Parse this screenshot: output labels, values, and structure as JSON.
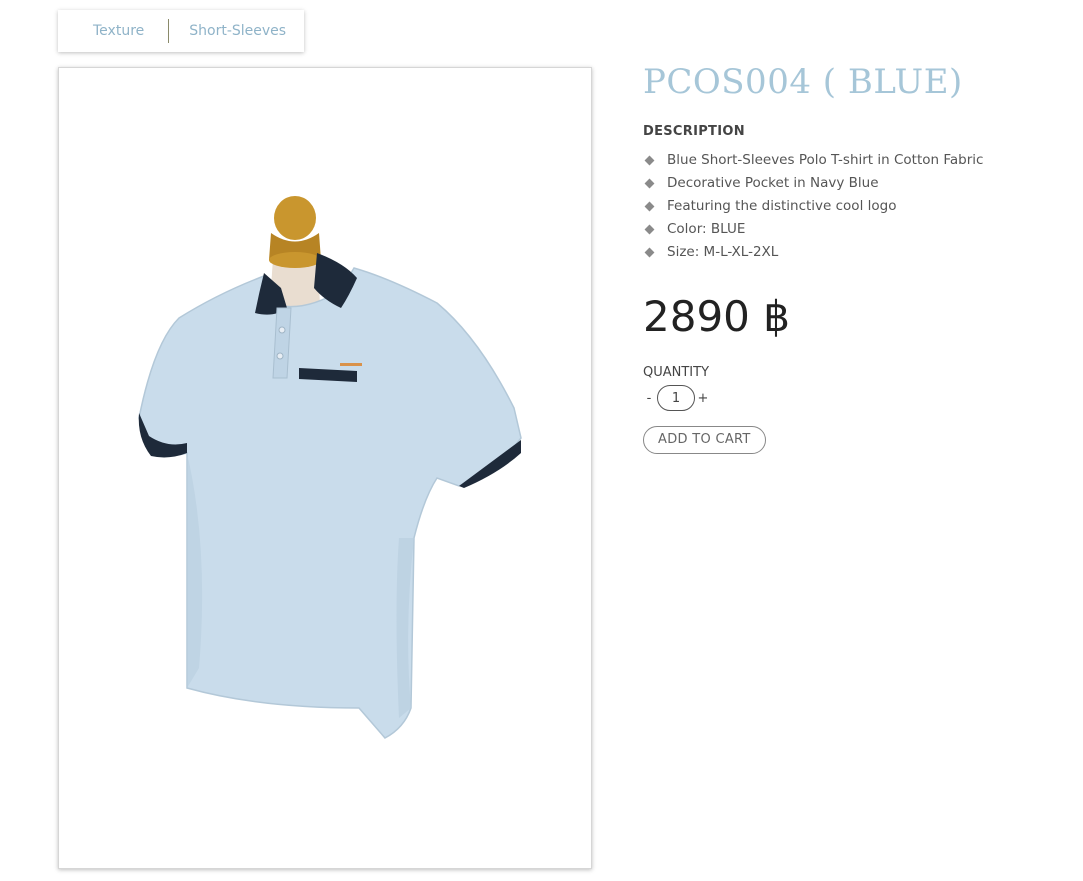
{
  "breadcrumb": {
    "tags": [
      "Texture",
      "Short-Sleeves"
    ]
  },
  "product": {
    "title": "PCOS004 ( BLUE)",
    "description_heading": "DESCRIPTION",
    "description_items": [
      "Blue Short-Sleeves Polo T-shirt in Cotton Fabric",
      "Decorative Pocket in Navy Blue",
      "Featuring the distinctive cool logo",
      "Color: BLUE",
      "Size: M-L-XL-2XL"
    ],
    "price": "2890 ฿",
    "quantity_label": "QUANTITY",
    "quantity_minus": "-",
    "quantity_value": "1",
    "quantity_plus": "+",
    "add_to_cart_label": "ADD TO CART"
  },
  "colors": {
    "title": "#a6c6d8",
    "tag_link": "#8fb3c8",
    "shirt": "#c9dceb",
    "trim": "#1e2a3a",
    "mannequin_head": "#c9962e"
  },
  "icons": {
    "bullet": "diamond-bullet-icon"
  }
}
